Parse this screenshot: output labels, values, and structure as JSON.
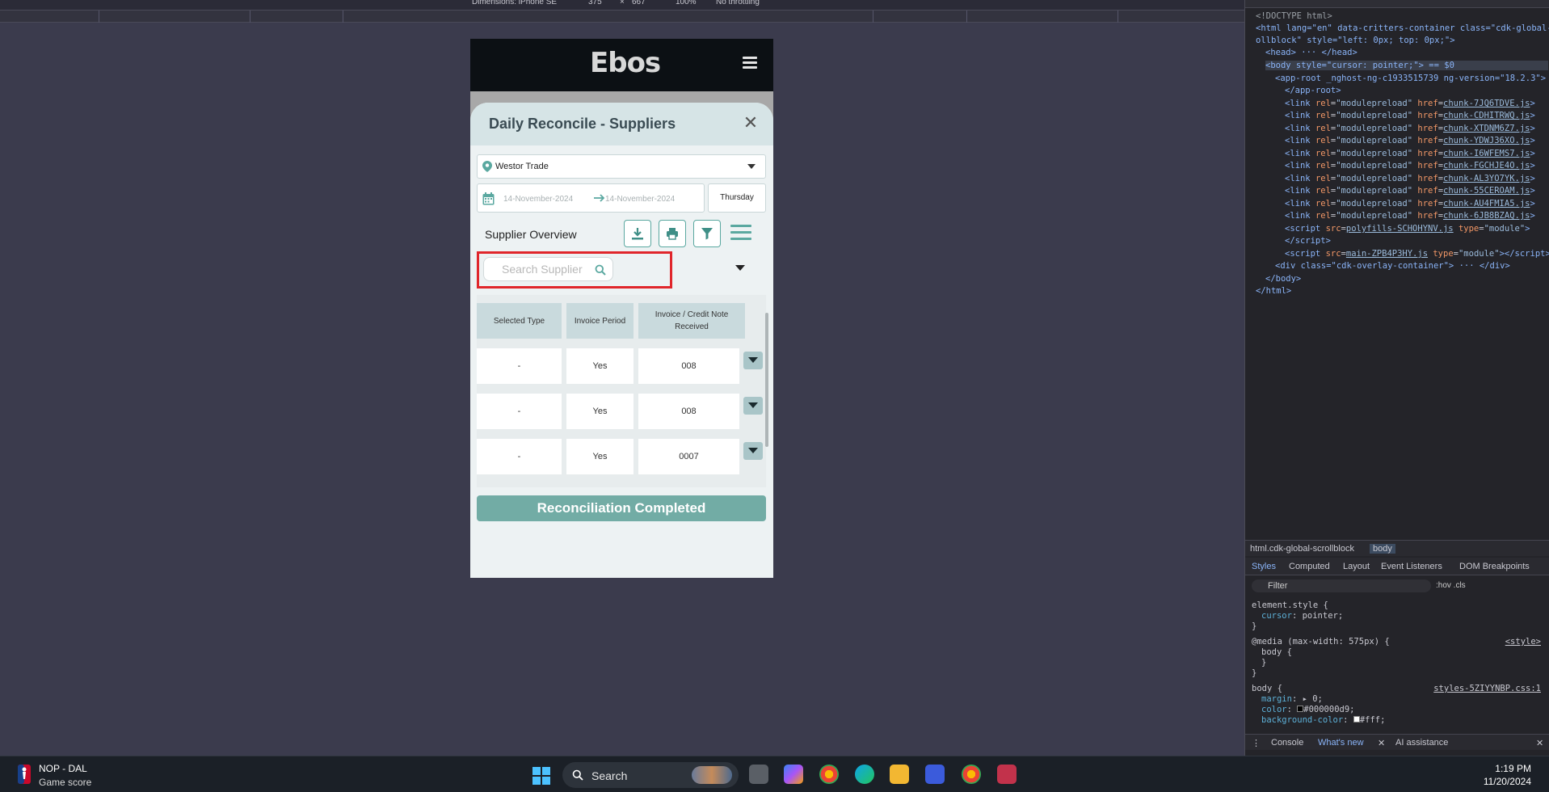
{
  "devtools_toolbar": {
    "dimensions": "Dimensions: iPhone SE",
    "width": "375",
    "times": "×",
    "height": "667",
    "zoom": "100%",
    "throttling": "No throttling"
  },
  "app": {
    "logo": "Ebos",
    "modal_title": "Daily Reconcile - Suppliers",
    "location": "Westor Trade",
    "date_from": "14-November-2024",
    "date_to": "14-November-2024",
    "day_name": "Thursday",
    "section_title": "Supplier Overview",
    "search_placeholder": "Search Supplier",
    "columns": [
      "Selected Type",
      "Invoice Period",
      "Invoice / Credit Note Received"
    ],
    "rows": [
      {
        "selected_type": "-",
        "invoice_period": "Yes",
        "received": "008"
      },
      {
        "selected_type": "-",
        "invoice_period": "Yes",
        "received": "008"
      },
      {
        "selected_type": "-",
        "invoice_period": "Yes",
        "received": "0007"
      }
    ],
    "complete_button": "Reconciliation Completed",
    "accent_color": "#72aca5",
    "highlight_color": "#e0262b"
  },
  "devtools": {
    "dom": {
      "doctype": "<!DOCTYPE html>",
      "html_open": "<html lang=\"en\" data-critters-container class=\"cdk-global-scr",
      "html_open_2": "ollblock\" style=\"left: 0px; top: 0px;\">",
      "head": "<head> ··· </head>",
      "body_open": "<body style=\"cursor: pointer;\"> == $0",
      "app_root": "<app-root _nghost-ng-c1933515739 ng-version=\"18.2.3\"> ···",
      "app_root_close": "</app-root>",
      "chunks": [
        "chunk-7JQ6TDVE.js",
        "chunk-CDHITRWQ.js",
        "chunk-XTDNM6Z7.js",
        "chunk-YDWJ36XO.js",
        "chunk-I6WFEMS7.js",
        "chunk-FGCHJE4O.js",
        "chunk-AL3YO7YK.js",
        "chunk-55CEROAM.js",
        "chunk-AU4FMIA5.js",
        "chunk-6JB8BZAQ.js"
      ],
      "polyfills": "polyfills-SCHOHYNV.js",
      "main": "main-ZPB4P3HY.js",
      "overlay": "<div class=\"cdk-overlay-container\"> ··· </div>",
      "body_close": "</body>",
      "html_close": "</html>"
    },
    "breadcrumbs": [
      "html.cdk-global-scrollblock",
      "body"
    ],
    "tabs": [
      "Styles",
      "Computed",
      "Layout",
      "Event Listeners",
      "DOM Breakpoints"
    ],
    "filter_placeholder": "Filter",
    "hov_cls": ":hov  .cls",
    "styles": {
      "element_style": "element.style {",
      "cursor_prop": "cursor",
      "cursor_val": "pointer;",
      "media": "@media (max-width: 575px) {",
      "media_src": "<style>",
      "body_sel": "body {",
      "body_src": "styles-5ZIYYNBP.css:1",
      "margin_prop": "margin",
      "margin_val": "▸ 0;",
      "color_prop": "color",
      "color_val": "#000000d9;",
      "bg_prop": "background-color",
      "bg_val": "#fff;"
    },
    "console_tabs": [
      "Console",
      "What's new",
      "AI assistance"
    ]
  },
  "taskbar": {
    "widget_title": "NOP - DAL",
    "widget_sub": "Game score",
    "search": "Search",
    "time": "1:19 PM",
    "date": "11/20/2024"
  }
}
